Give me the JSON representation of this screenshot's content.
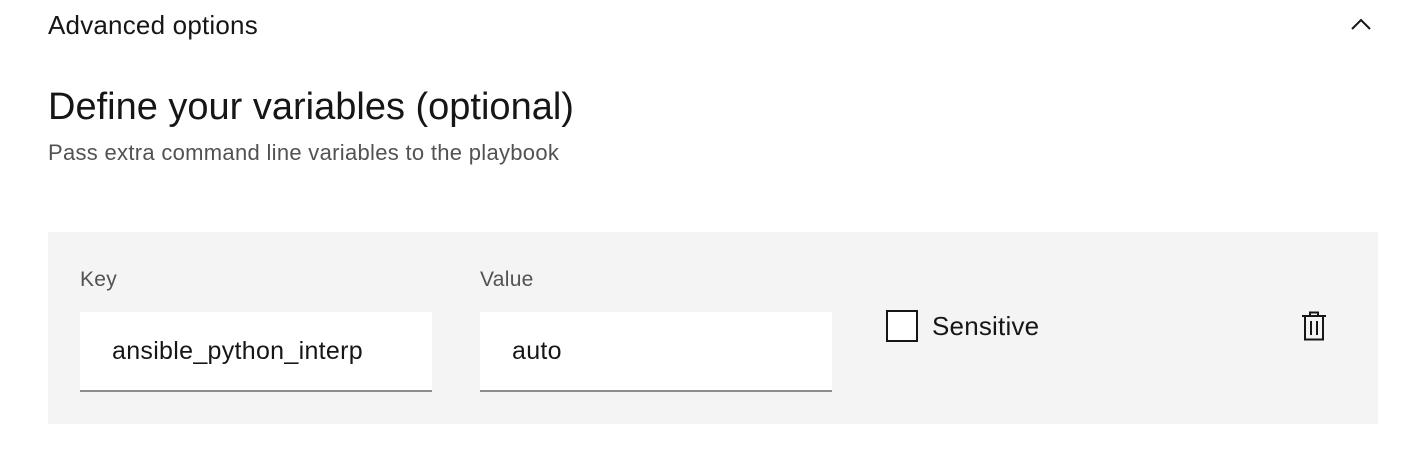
{
  "accordion": {
    "title": "Advanced options",
    "expanded": true,
    "icon": "chevron-up-icon"
  },
  "section": {
    "title": "Define your variables (optional)",
    "subtitle": "Pass extra command line variables to the playbook"
  },
  "variables": {
    "key_label": "Key",
    "value_label": "Value",
    "rows": [
      {
        "key": "ansible_python_interp",
        "value": "auto",
        "sensitive_label": "Sensitive",
        "sensitive_checked": false,
        "delete_icon": "trash-icon"
      }
    ]
  },
  "colors": {
    "panel_background": "#f4f4f4",
    "text_primary": "#161616",
    "text_secondary": "#525252",
    "input_border": "#8d8d8d"
  }
}
